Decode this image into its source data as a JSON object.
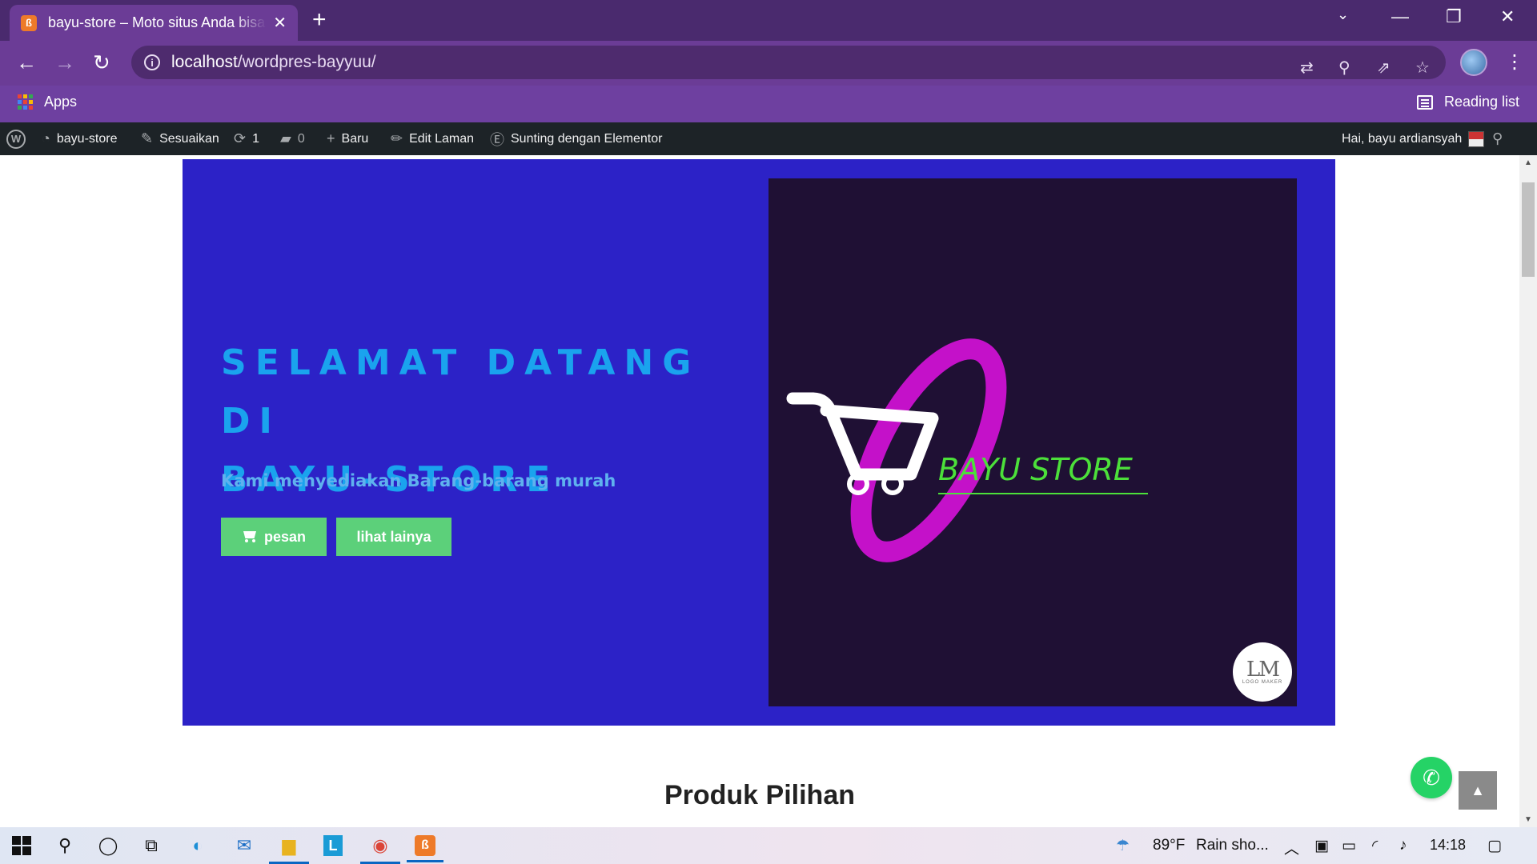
{
  "browser": {
    "tab_title": "bayu-store – Moto situs Anda bisa",
    "tab_close": "✕",
    "new_tab": "+",
    "url_host": "localhost",
    "url_path": "/wordpres-bayyuu/",
    "bookmarks_apps": "Apps",
    "reading_list": "Reading list"
  },
  "adminbar": {
    "site_name": "bayu-store",
    "customize": "Sesuaikan",
    "updates_count": "1",
    "comments_count": "0",
    "new": "Baru",
    "edit_page": "Edit Laman",
    "elementor": "Sunting dengan Elementor",
    "greeting": "Hai, bayu ardiansyah"
  },
  "hero": {
    "title_line1": "SELAMAT DATANG DI",
    "title_line2": "BAYU-STORE",
    "subtitle": "Kami menyediakan Barang-barang murah",
    "btn_order": "pesan",
    "btn_more": "lihat lainya",
    "logo_text": "BAYU STORE",
    "badge_text": "LM",
    "badge_sub": "LOGO MAKER"
  },
  "section": {
    "title": "Produk Pilihan"
  },
  "taskbar": {
    "weather_temp": "89°F",
    "weather_text": "Rain sho...",
    "time": "14:18"
  },
  "colors": {
    "hero_bg": "#2c22c7",
    "hero_title": "#1aa3ee",
    "button_green": "#5cd07a",
    "logo_bg": "#1f1034",
    "logo_magenta": "#c411c9",
    "logo_green": "#4ce03a",
    "browser_purple": "#6b3c96"
  }
}
